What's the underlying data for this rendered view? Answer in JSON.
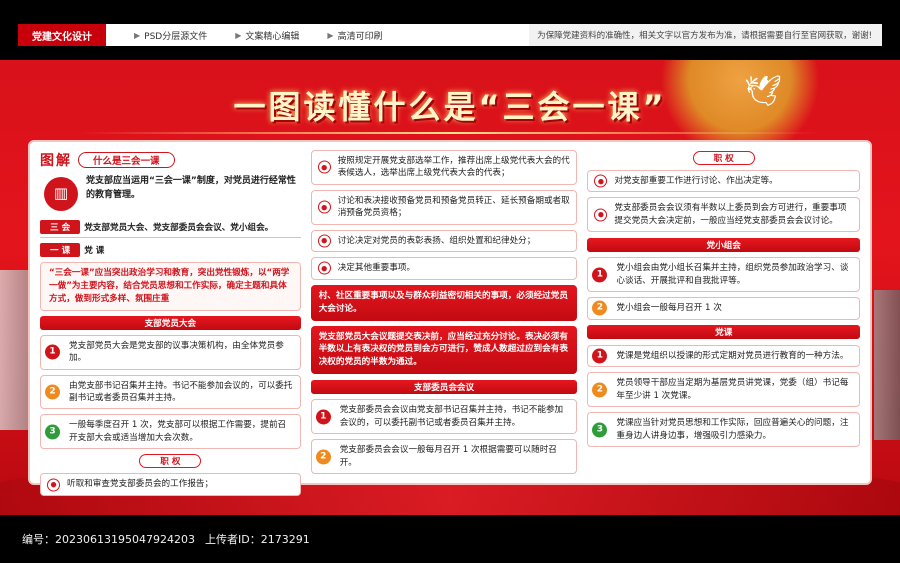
{
  "topbar": {
    "brand": "党建文化设计",
    "features": [
      "PSD分层源文件",
      "文案精心编辑",
      "高清可印刷"
    ],
    "note": "为保障党建资料的准确性，相关文字以官方发布为准，请根据需要自行至官网获取，谢谢!"
  },
  "poster": {
    "title": "一图读懂什么是“三会一课”"
  },
  "col1": {
    "heading": "图解",
    "heading_pill": "什么是三会一课",
    "intro": "党支部应当运用“三会一课”制度，对党员进行经常性的教育管理。",
    "sanhui_tag": "三 会",
    "sanhui_text": "党支部党员大会、党支部委员会会议、党小组会。",
    "yike_tag": "一 课",
    "yike_text": "党 课",
    "course_text": "“三会一课”应当突出政治学习和教育，突出党性锻炼，以“两学一做”为主要内容，结合党员思想和工作实际，确定主题和具体方式，做到形式多样、氛围庄重",
    "members_meeting_title": "支部党员大会",
    "members_items": [
      "党支部党员大会是党支部的议事决策机构，由全体党员参加。",
      "由党支部书记召集并主持。书记不能参加会议的，可以委托副书记或者委员召集并主持。",
      "一般每季度召开 1 次，党支部可以根据工作需要，提前召开支部大会或适当增加大会次数。"
    ],
    "duty_title": "职 权",
    "duty_item": "听取和审查党支部委员会的工作报告；"
  },
  "col2": {
    "items": [
      "按照规定开展党支部选举工作，推荐出席上级党代表大会的代表候选人，选举出席上级党代表大会的代表；",
      "讨论和表决接收预备党员和预备党员转正、延长预备期或者取消预备党员资格；",
      "讨论决定对党员的表彰表扬、组织处置和纪律处分；",
      "决定其他重要事项。"
    ],
    "red_note_1": "村、社区重要事项以及与群众利益密切相关的事项，必须经过党员大会讨论。",
    "red_note_2": "党支部党员大会议题提交表决前，应当经过充分讨论。表决必须有半数以上有表决权的党员到会方可进行，赞成人数超过应到会有表决权的党员的半数为通过。",
    "committee_title": "支部委员会会议",
    "committee_items": [
      "党支部委员会会议由党支部书记召集并主持，书记不能参加会议的，可以委托副书记或者委员召集并主持。",
      "党支部委员会会议一般每月召开 1 次根据需要可以随时召开。"
    ]
  },
  "col3": {
    "duty_title": "职 权",
    "duty_items": [
      "对党支部重要工作进行讨论、作出决定等。",
      "党支部委员会会议须有半数以上委员到会方可进行，重要事项提交党员大会决定前，一般应当经党支部委员会会议讨论。"
    ],
    "group_title": "党小组会",
    "group_items": [
      "党小组会由党小组长召集并主持，组织党员参加政治学习、谈心谈话、开展批评和自我批评等。",
      "党小组会一般每月召开 1 次"
    ],
    "lesson_title": "党课",
    "lesson_items": [
      "党课是党组织以授课的形式定期对党员进行教育的一种方法。",
      "党员领导干部应当定期为基层党员讲党课，党委（组）书记每年至少讲 1 次党课。",
      "党课应当针对党员思想和工作实际，回应普遍关心的问题，注重身边人讲身边事，增强吸引力感染力。"
    ]
  },
  "footer": {
    "id_label": "编号：",
    "id_value": "20230613195047924203",
    "uploader_label": "上传者ID：",
    "uploader_value": "2173291"
  }
}
